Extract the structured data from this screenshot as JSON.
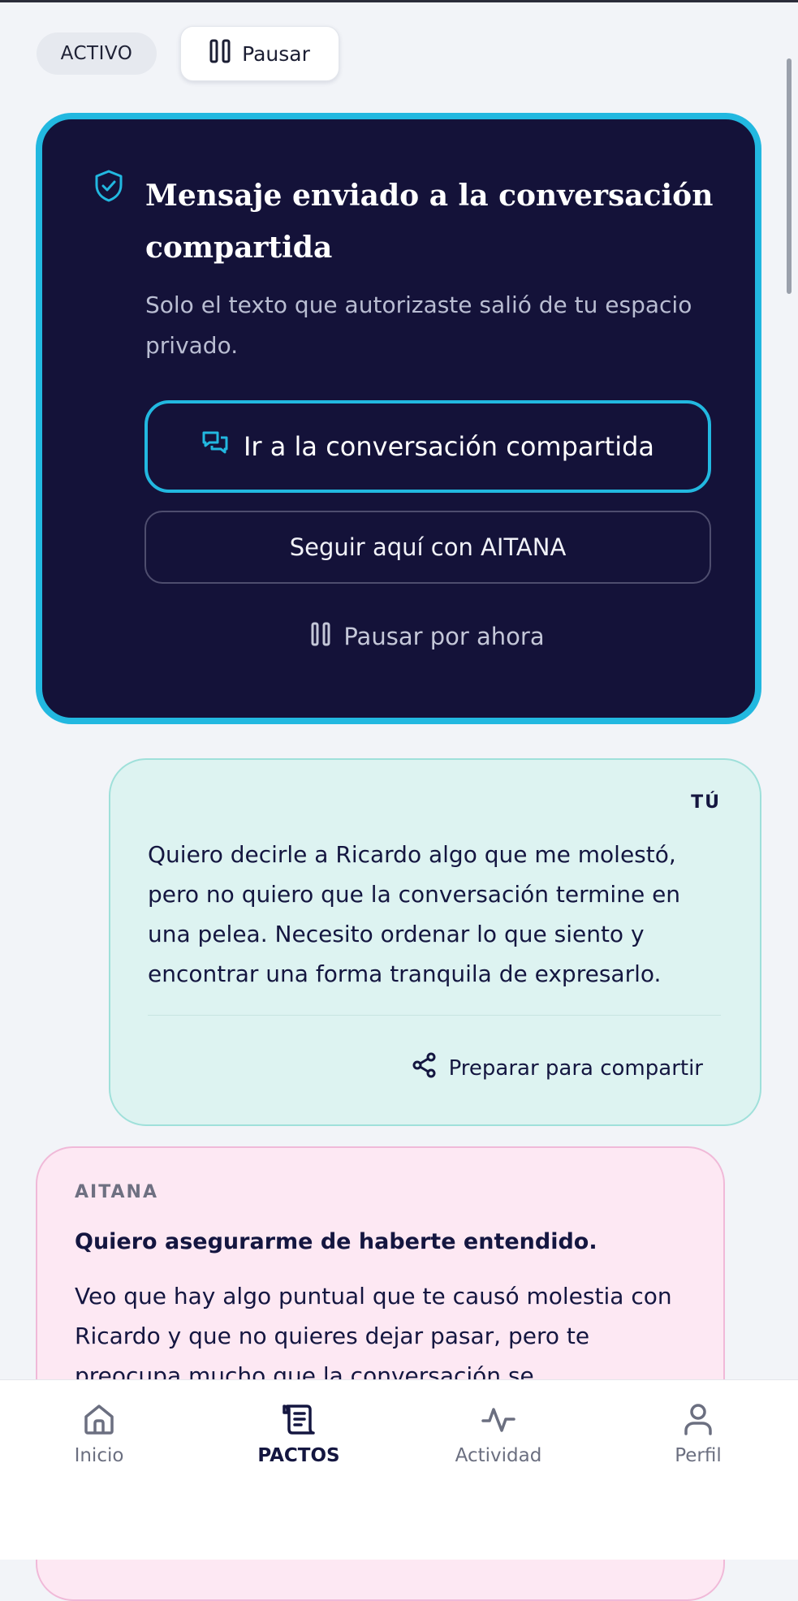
{
  "colors": {
    "accent": "#22b8e0",
    "card_dark": "#141239",
    "user_bubble": "#ddf3f1",
    "ai_bubble": "#fde8f3",
    "text_primary": "#141640"
  },
  "header": {
    "status_chip": "ACTIVO",
    "pause_label": "Pausar"
  },
  "sent_card": {
    "title": "Mensaje enviado a la conversación compartida",
    "subtitle": "Solo el texto que autorizaste salió de tu espacio privado.",
    "primary_label": "Ir a la conversación compartida",
    "secondary_label": "Seguir aquí con AITANA",
    "pause_now_label": "Pausar por ahora"
  },
  "user_message": {
    "author": "TÚ",
    "text": "Quiero decirle a Ricardo algo que me molestó, pero no quiero que la conversación termine en una pelea. Necesito ordenar lo que siento y encontrar una forma tranquila de expresarlo.",
    "share_label": "Preparar para compartir"
  },
  "ai_message": {
    "author": "AITANA",
    "heading": "Quiero asegurarme de haberte entendido.",
    "text": "Veo que hay algo puntual que te causó molestia con Ricardo y que no quieres dejar pasar, pero te preocupa mucho que la conversación se"
  },
  "nav": {
    "items": [
      {
        "label": "Inicio",
        "icon": "home-icon"
      },
      {
        "label": "PACTOS",
        "icon": "scroll-icon"
      },
      {
        "label": "Actividad",
        "icon": "activity-icon"
      },
      {
        "label": "Perfil",
        "icon": "profile-icon"
      }
    ],
    "active_index": 1
  }
}
